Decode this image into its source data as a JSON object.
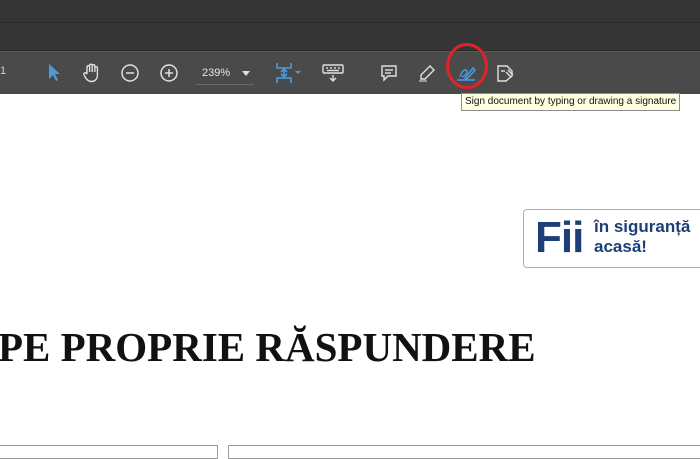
{
  "toolbar": {
    "page_number": "1",
    "zoom": "239%",
    "tools": [
      {
        "name": "select-tool",
        "icon": "arrow-pointer-icon"
      },
      {
        "name": "hand-tool",
        "icon": "hand-icon"
      },
      {
        "name": "zoom-out",
        "icon": "minus-circle-icon"
      },
      {
        "name": "zoom-in",
        "icon": "plus-circle-icon"
      },
      {
        "name": "fit-page",
        "icon": "fit-page-icon"
      },
      {
        "name": "scroll-mode",
        "icon": "keyboard-icon"
      },
      {
        "name": "comment",
        "icon": "comment-icon"
      },
      {
        "name": "highlight",
        "icon": "pen-icon"
      },
      {
        "name": "sign",
        "icon": "sign-pen-icon"
      },
      {
        "name": "stamp",
        "icon": "stamp-icon"
      }
    ],
    "accent_color": "#4a9be0"
  },
  "tooltip": "Sign document by typing or drawing a signature",
  "badge": {
    "big": "Fii",
    "line1": "în siguranță",
    "line2": "acasă!"
  },
  "document": {
    "heading": "PE PROPRIE RĂSPUNDERE"
  }
}
